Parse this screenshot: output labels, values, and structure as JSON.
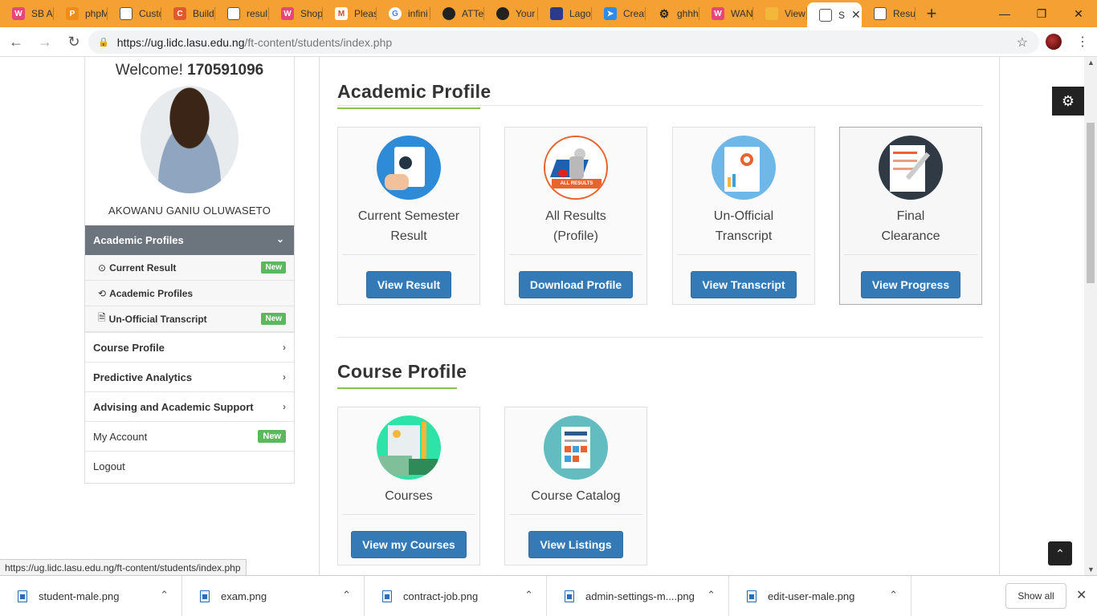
{
  "browser": {
    "tabs": [
      {
        "title": "SB Ai",
        "icon": "w",
        "color": "#e8457a"
      },
      {
        "title": "phpM",
        "icon": "pma",
        "color": "#f08c1a"
      },
      {
        "title": "Custo",
        "icon": "doc",
        "color": "#ffffff"
      },
      {
        "title": "Build",
        "icon": "c",
        "color": "#e05a2b"
      },
      {
        "title": "resul",
        "icon": "doc",
        "color": "#ffffff"
      },
      {
        "title": "Shop",
        "icon": "w",
        "color": "#e8457a"
      },
      {
        "title": "Pleas",
        "icon": "m",
        "color": "#d44638"
      },
      {
        "title": "infini",
        "icon": "g",
        "color": "#4285f4"
      },
      {
        "title": "ATTe",
        "icon": "gh",
        "color": "#222222"
      },
      {
        "title": "Your",
        "icon": "gh",
        "color": "#222222"
      },
      {
        "title": "Lago",
        "icon": "lasu",
        "color": "#2b3a8c"
      },
      {
        "title": "Creat",
        "icon": "cursor",
        "color": "#2d8ceb"
      },
      {
        "title": "ghhh",
        "icon": "gear",
        "color": "#222222"
      },
      {
        "title": "WAN",
        "icon": "w",
        "color": "#e8457a"
      },
      {
        "title": "View",
        "icon": "cal",
        "color": "#f3b73b"
      },
      {
        "title": "S",
        "icon": "doc",
        "color": "#ffffff",
        "active": true
      },
      {
        "title": "Resu",
        "icon": "doc",
        "color": "#ffffff"
      }
    ],
    "url_host": "https://ug.lidc.lasu.edu.ng",
    "url_path": "/ft-content/students/index.php",
    "status_url": "https://ug.lidc.lasu.edu.ng/ft-content/students/index.php"
  },
  "sidebar": {
    "welcome_prefix": "Welcome!",
    "matric": "170591096",
    "student_name": "AKOWANU GANIU OLUWASETO",
    "menu_head": "Academic Profiles",
    "sub_items": [
      {
        "icon": "⊙",
        "label": "Current Result",
        "badge": "New"
      },
      {
        "icon": "⟲",
        "label": "Academic Profiles",
        "badge": ""
      },
      {
        "icon": "🗎",
        "label": "Un-Official Transcript",
        "badge": "New"
      }
    ],
    "items": [
      {
        "label": "Course Profile"
      },
      {
        "label": "Predictive Analytics"
      },
      {
        "label": "Advising and Academic Support"
      }
    ],
    "my_account": "My Account",
    "my_account_badge": "New",
    "logout": "Logout"
  },
  "academic": {
    "title": "Academic Profile",
    "cards": [
      {
        "label1": "Current Semester",
        "label2": "Result",
        "button": "View Result"
      },
      {
        "label1": "All Results",
        "label2": "(Profile)",
        "button": "Download Profile",
        "img_caption": "ALL RESULTS"
      },
      {
        "label1": "Un-Official",
        "label2": "Transcript",
        "button": "View Transcript"
      },
      {
        "label1": "Final",
        "label2": "Clearance",
        "button": "View Progress"
      }
    ]
  },
  "course": {
    "title": "Course Profile",
    "cards": [
      {
        "label1": "Courses",
        "button": "View my Courses"
      },
      {
        "label1": "Course Catalog",
        "button": "View Listings"
      }
    ]
  },
  "downloads": {
    "files": [
      "student-male.png",
      "exam.png",
      "contract-job.png",
      "admin-settings-m....png",
      "edit-user-male.png"
    ],
    "show_all": "Show all"
  }
}
